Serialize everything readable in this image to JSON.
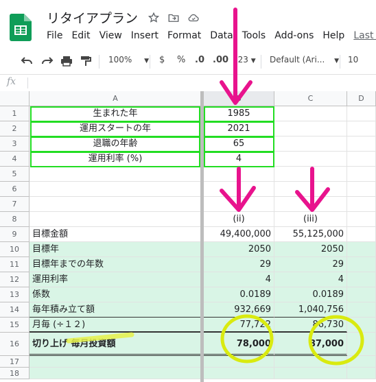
{
  "app": {
    "doc_title": "リタイアプラン",
    "menu": [
      "File",
      "Edit",
      "View",
      "Insert",
      "Format",
      "Data",
      "Tools",
      "Add-ons",
      "Help",
      "Last e"
    ]
  },
  "toolbar": {
    "zoom": "100%",
    "currency": "$",
    "percent": "%",
    "dec_decrease": ".0",
    "dec_increase": ".00",
    "more_formats": "123",
    "font": "Default (Ari...",
    "font_size": "10"
  },
  "formula_bar": {
    "fx": "fx"
  },
  "grid": {
    "columns": [
      "A",
      "B",
      "C",
      "D"
    ],
    "rows": [
      "1",
      "2",
      "3",
      "4",
      "5",
      "6",
      "7",
      "8",
      "9",
      "10",
      "11",
      "12",
      "13",
      "14",
      "15",
      "16",
      "17",
      "18"
    ],
    "inputs": [
      {
        "label": "生まれた年",
        "value": "1985"
      },
      {
        "label": "運用スタートの年",
        "value": "2021"
      },
      {
        "label": "退職の年齢",
        "value": "65"
      },
      {
        "label": "運用利率 (%)",
        "value": "4"
      }
    ],
    "row8": {
      "b": "(ii)",
      "c": "(iii)"
    },
    "calc": [
      {
        "label": "目標金額",
        "b": "49,400,000",
        "c": "55,125,000"
      },
      {
        "label": "目標年",
        "b": "2050",
        "c": "2050"
      },
      {
        "label": "目標年までの年数",
        "b": "29",
        "c": "29"
      },
      {
        "label": "運用利率",
        "b": "4",
        "c": "4"
      },
      {
        "label": "係数",
        "b": "0.0189",
        "c": "0.0189"
      },
      {
        "label": "毎年積み立て額",
        "b": "932,669",
        "c": "1,040,756"
      },
      {
        "label": "月毎 (÷１２)",
        "b": "77,722",
        "c": "86,730"
      },
      {
        "label": "切り上げ 毎月投資額",
        "b": "78,000",
        "c": "87,000"
      }
    ]
  },
  "annotations": {
    "arrow_color": "#e8138d",
    "circle_color": "#d9ea10",
    "highlight_color": "#e6f24a"
  }
}
